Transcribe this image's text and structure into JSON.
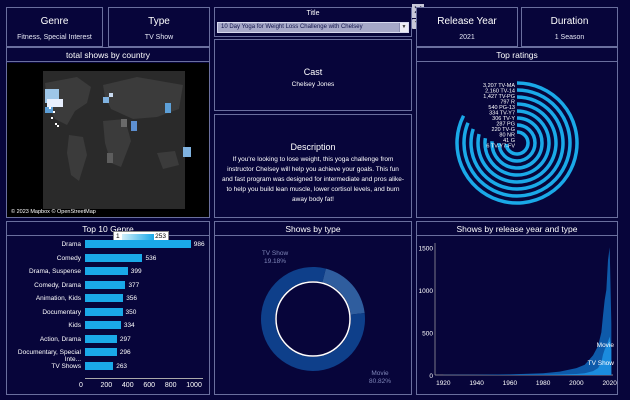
{
  "kpis": {
    "genre": {
      "title": "Genre",
      "value": "Fitness, Special Interest"
    },
    "type": {
      "title": "Type",
      "value": "TV Show"
    },
    "release_year": {
      "title": "Release Year",
      "value": "2021"
    },
    "duration": {
      "title": "Duration",
      "value": "1 Season"
    }
  },
  "title_filter": {
    "label": "Title",
    "selected": "10 Day Yoga for Weight Loss Challenge with Chelsey"
  },
  "cast": {
    "header": "Cast",
    "value": "Chelsey Jones"
  },
  "description": {
    "header": "Description",
    "text": "If you're looking to lose weight, this yoga challenge from instructor Chelsey will help you achieve your goals. This fun and fast program was designed for intermediate and pros alike- to help you build lean muscle, lower cortisol levels, and burn away body fat!"
  },
  "map": {
    "title": "total shows by country",
    "attribution": "© 2023 Mapbox © OpenStreetMap"
  },
  "top_ratings": {
    "title": "Top ratings",
    "labels": [
      "3,207 TV-MA",
      "2,160 TV-14",
      "1,427 TV-PG",
      "797 R",
      "540 PG-13",
      "334 TV-Y7",
      "306 TV-Y",
      "287 PG",
      "220 TV-G",
      "80 NR",
      "41 G",
      "6 TV-Y7-FV"
    ],
    "colors": {
      "arc": "#1aa9e8"
    }
  },
  "top_genre": {
    "title": "Top 10 Genre",
    "legend_min": "1",
    "legend_max": "253",
    "axis_ticks": [
      "0",
      "200",
      "400",
      "600",
      "800",
      "1000"
    ]
  },
  "shows_by_type": {
    "title": "Shows by type"
  },
  "release_year_chart": {
    "title": "Shows by release year and type",
    "x_ticks": [
      "1920",
      "1940",
      "1960",
      "1980",
      "2000",
      "2020"
    ],
    "y_ticks": [
      "1500",
      "1000",
      "500",
      "0"
    ],
    "labels": {
      "movie": "Movie",
      "tv": "TV Show"
    }
  },
  "chart_data": [
    {
      "type": "bar",
      "title": "Top 10 Genre",
      "categories": [
        "Drama",
        "Comedy",
        "Drama, Suspense",
        "Comedy, Drama",
        "Animation, Kids",
        "Documentary",
        "Kids",
        "Action, Drama",
        "Documentary, Special Inte...",
        "TV Shows"
      ],
      "values": [
        986,
        536,
        399,
        377,
        356,
        350,
        334,
        297,
        296,
        263
      ],
      "xlim": [
        0,
        1100
      ],
      "colors": {
        "bar": "#1aa9e8"
      }
    },
    {
      "type": "pie",
      "title": "Shows by type",
      "categories": [
        "TV Show",
        "Movie"
      ],
      "labels": [
        "TV Show\n19.18%",
        "Movie\n80.82%"
      ],
      "values": [
        19.18,
        80.82
      ],
      "colors": [
        "#2f5d9e",
        "#0e3f8a"
      ]
    },
    {
      "type": "area",
      "title": "Shows by release year and type",
      "x": [
        1920,
        1940,
        1960,
        1980,
        1990,
        2000,
        2005,
        2010,
        2013,
        2015,
        2016,
        2017,
        2018,
        2019,
        2020,
        2021
      ],
      "series": [
        {
          "name": "Movie",
          "values": [
            2,
            3,
            8,
            20,
            40,
            80,
            120,
            230,
            340,
            500,
            700,
            880,
            1000,
            1350,
            1500,
            600
          ]
        },
        {
          "name": "TV Show",
          "values": [
            0,
            0,
            1,
            3,
            6,
            12,
            20,
            45,
            80,
            150,
            240,
            300,
            340,
            390,
            450,
            300
          ]
        }
      ],
      "ylim": [
        0,
        1550
      ],
      "xlim": [
        1915,
        2022
      ],
      "colors": {
        "Movie": "#0f5fb0",
        "TV Show": "#1c8fe0"
      }
    }
  ]
}
